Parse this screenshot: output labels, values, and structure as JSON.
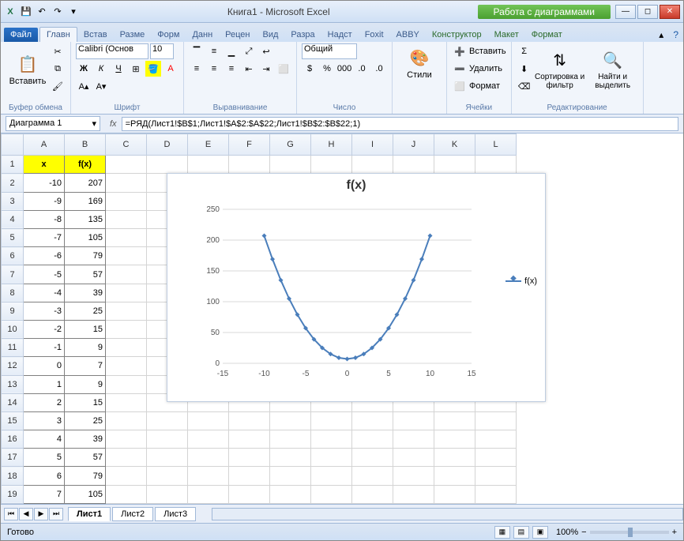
{
  "title": {
    "doc": "Книга1",
    "app": "Microsoft Excel",
    "chart_tools": "Работа с диаграммами"
  },
  "qat": {
    "excel": "X",
    "save": "💾",
    "undo": "↶",
    "redo": "↷",
    "more": "▾"
  },
  "tabs": {
    "file": "Файл",
    "home": "Главн",
    "insert": "Встав",
    "layout": "Разме",
    "form": "Форм",
    "data": "Данн",
    "review": "Рецен",
    "view": "Вид",
    "dev": "Разра",
    "addin": "Надст",
    "foxit": "Foxit",
    "abbyy": "ABBY",
    "design": "Конструктор",
    "layout2": "Макет",
    "format": "Формат"
  },
  "ribbon": {
    "clipboard": {
      "paste": "Вставить",
      "label": "Буфер обмена"
    },
    "font": {
      "name": "Calibri (Основ",
      "size": "10",
      "label": "Шрифт"
    },
    "align": {
      "label": "Выравнивание"
    },
    "number": {
      "format": "Общий",
      "label": "Число"
    },
    "styles": {
      "btn": "Стили",
      "label": ""
    },
    "cells": {
      "insert": "Вставить",
      "delete": "Удалить",
      "format": "Формат",
      "label": "Ячейки"
    },
    "editing": {
      "sort": "Сортировка и фильтр",
      "find": "Найти и выделить",
      "label": "Редактирование"
    }
  },
  "formula_bar": {
    "name": "Диаграмма 1",
    "fx": "fx",
    "formula": "=РЯД(Лист1!$B$1;Лист1!$A$2:$A$22;Лист1!$B$2:$B$22;1)"
  },
  "columns": [
    "A",
    "B",
    "C",
    "D",
    "E",
    "F",
    "G",
    "H",
    "I",
    "J",
    "K",
    "L"
  ],
  "headers": {
    "x": "x",
    "fx": "f(x)"
  },
  "table": [
    {
      "r": 2,
      "x": -10,
      "fx": 207
    },
    {
      "r": 3,
      "x": -9,
      "fx": 169
    },
    {
      "r": 4,
      "x": -8,
      "fx": 135
    },
    {
      "r": 5,
      "x": -7,
      "fx": 105
    },
    {
      "r": 6,
      "x": -6,
      "fx": 79
    },
    {
      "r": 7,
      "x": -5,
      "fx": 57
    },
    {
      "r": 8,
      "x": -4,
      "fx": 39
    },
    {
      "r": 9,
      "x": -3,
      "fx": 25
    },
    {
      "r": 10,
      "x": -2,
      "fx": 15
    },
    {
      "r": 11,
      "x": -1,
      "fx": 9
    },
    {
      "r": 12,
      "x": 0,
      "fx": 7
    },
    {
      "r": 13,
      "x": 1,
      "fx": 9
    },
    {
      "r": 14,
      "x": 2,
      "fx": 15
    },
    {
      "r": 15,
      "x": 3,
      "fx": 25
    },
    {
      "r": 16,
      "x": 4,
      "fx": 39
    },
    {
      "r": 17,
      "x": 5,
      "fx": 57
    },
    {
      "r": 18,
      "x": 6,
      "fx": 79
    },
    {
      "r": 19,
      "x": 7,
      "fx": 105
    }
  ],
  "chart_data": {
    "type": "line",
    "title": "f(x)",
    "legend": "f(x)",
    "x": [
      -10,
      -9,
      -8,
      -7,
      -6,
      -5,
      -4,
      -3,
      -2,
      -1,
      0,
      1,
      2,
      3,
      4,
      5,
      6,
      7,
      8,
      9,
      10
    ],
    "y": [
      207,
      169,
      135,
      105,
      79,
      57,
      39,
      25,
      15,
      9,
      7,
      9,
      15,
      25,
      39,
      57,
      79,
      105,
      135,
      169,
      207
    ],
    "xlim": [
      -15,
      15
    ],
    "ylim": [
      0,
      250
    ],
    "xticks": [
      -15,
      -10,
      -5,
      0,
      5,
      10,
      15
    ],
    "yticks": [
      0,
      50,
      100,
      150,
      200,
      250
    ]
  },
  "sheet_tabs": {
    "s1": "Лист1",
    "s2": "Лист2",
    "s3": "Лист3"
  },
  "status": {
    "ready": "Готово",
    "zoom": "100%"
  }
}
